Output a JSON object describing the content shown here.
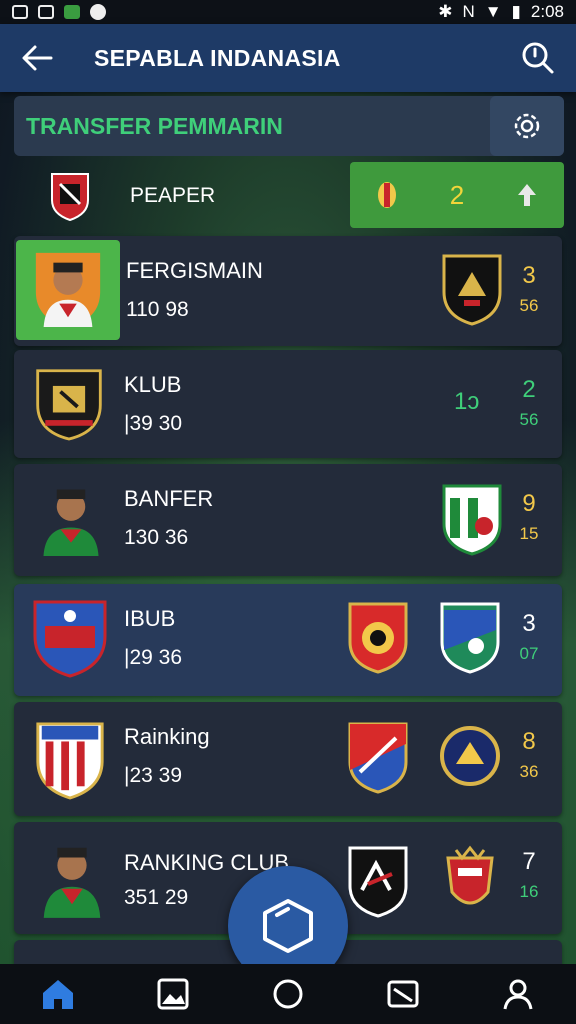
{
  "status_bar": {
    "time": "2:08"
  },
  "header": {
    "title": "SEPABLA INDANASIA"
  },
  "section": {
    "title": "TRANSFER PEMMARIN"
  },
  "peaper": {
    "name": "PEAPER",
    "score": "2"
  },
  "rows": [
    {
      "name": "FERGISMAIN",
      "value": "110 98",
      "stat1": "3",
      "stat2": "56",
      "stat_color": "gold"
    },
    {
      "name": "KLUB",
      "value": "|39 30",
      "mid": "1ↄ",
      "stat1": "2",
      "stat2": "56",
      "stat_color": "green"
    },
    {
      "name": "BANFER",
      "value": "130 36",
      "stat1": "9",
      "stat2": "15",
      "stat_color": "gold"
    },
    {
      "name": "IBUB",
      "value": "|29 36",
      "stat1": "3",
      "stat2": "07",
      "stat_color": "white"
    },
    {
      "name": "Rainking",
      "value": "|23 39",
      "stat1": "8",
      "stat2": "36",
      "stat_color": "gold"
    },
    {
      "name": "RANKING CLUB",
      "value": "351 29",
      "stat1": "7",
      "stat2": "16",
      "stat_color": "white"
    }
  ],
  "icons": [
    "back-arrow-icon",
    "search-icon",
    "gear-icon",
    "home-icon",
    "gallery-icon",
    "ball-icon",
    "cast-icon",
    "profile-icon",
    "hexagon-icon"
  ],
  "colors": {
    "accent_green": "#3fcf7a",
    "header_blue": "#1e3a66",
    "gold": "#f2c84a",
    "fab_blue": "#2a5aa3"
  }
}
